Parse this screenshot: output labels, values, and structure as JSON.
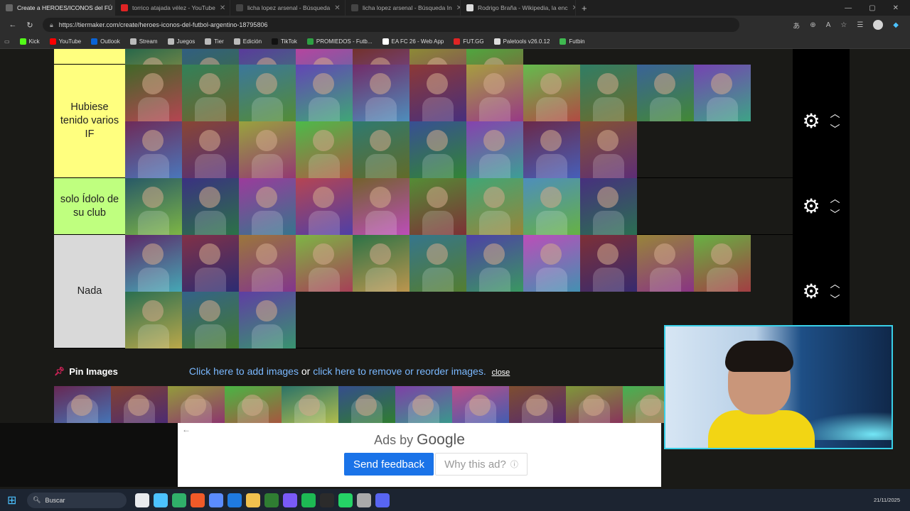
{
  "browser": {
    "tabs": [
      {
        "label": "Create a HEROES/ICONOS del FÚ",
        "color": "#666666",
        "active": true
      },
      {
        "label": "torrico atajada vélez - YouTube",
        "color": "#e02424",
        "active": false
      },
      {
        "label": "licha lopez arsenal - Búsqueda",
        "color": "#444444",
        "active": false
      },
      {
        "label": "licha lopez arsenal - Búsqueda In",
        "color": "#444444",
        "active": false
      },
      {
        "label": "Rodrigo Braña - Wikipedia, la enc",
        "color": "#dddddd",
        "active": false
      }
    ],
    "url": "https://tiermaker.com/create/heroes-iconos-del-futbol-argentino-18795806",
    "bookmarks": [
      {
        "label": "Kick",
        "color": "#53fc18"
      },
      {
        "label": "YouTube",
        "color": "#ff0000"
      },
      {
        "label": "Outlook",
        "color": "#0a64d6"
      },
      {
        "label": "Stream",
        "color": "#bbbbbb"
      },
      {
        "label": "Juegos",
        "color": "#bbbbbb"
      },
      {
        "label": "Tier",
        "color": "#bbbbbb"
      },
      {
        "label": "Edición",
        "color": "#bbbbbb"
      },
      {
        "label": "TikTok",
        "color": "#111111"
      },
      {
        "label": "PROMIEDOS - Futb...",
        "color": "#2ea043"
      },
      {
        "label": "EA FC 26 - Web App",
        "color": "#ffffff"
      },
      {
        "label": "FUT.GG",
        "color": "#e02424"
      },
      {
        "label": "Paletools v26.0.12",
        "color": "#dddddd"
      },
      {
        "label": "Futbin",
        "color": "#3fb950"
      }
    ]
  },
  "tiers": [
    {
      "label": "Hubiese tenido varios IF",
      "color": "#ffff7f",
      "items": 20,
      "height": 160
    },
    {
      "label": "solo Ídolo de su club",
      "color": "#bfff7f",
      "items": 9,
      "height": 80
    },
    {
      "label": "Nada",
      "color": "#d9d9d9",
      "items": 14,
      "height": 160
    }
  ],
  "pin": {
    "title": "Pin Images",
    "add_link": "Click here to add images",
    "or": "or",
    "remove_link": "click here to remove or reorder images.",
    "close": "close"
  },
  "pool_count": 11,
  "ad": {
    "ads_by": "Ads by",
    "google": "Google",
    "send_feedback": "Send feedback",
    "why": "Why this ad?"
  },
  "taskbar": {
    "search": "Buscar",
    "date": "21/11/2025"
  }
}
